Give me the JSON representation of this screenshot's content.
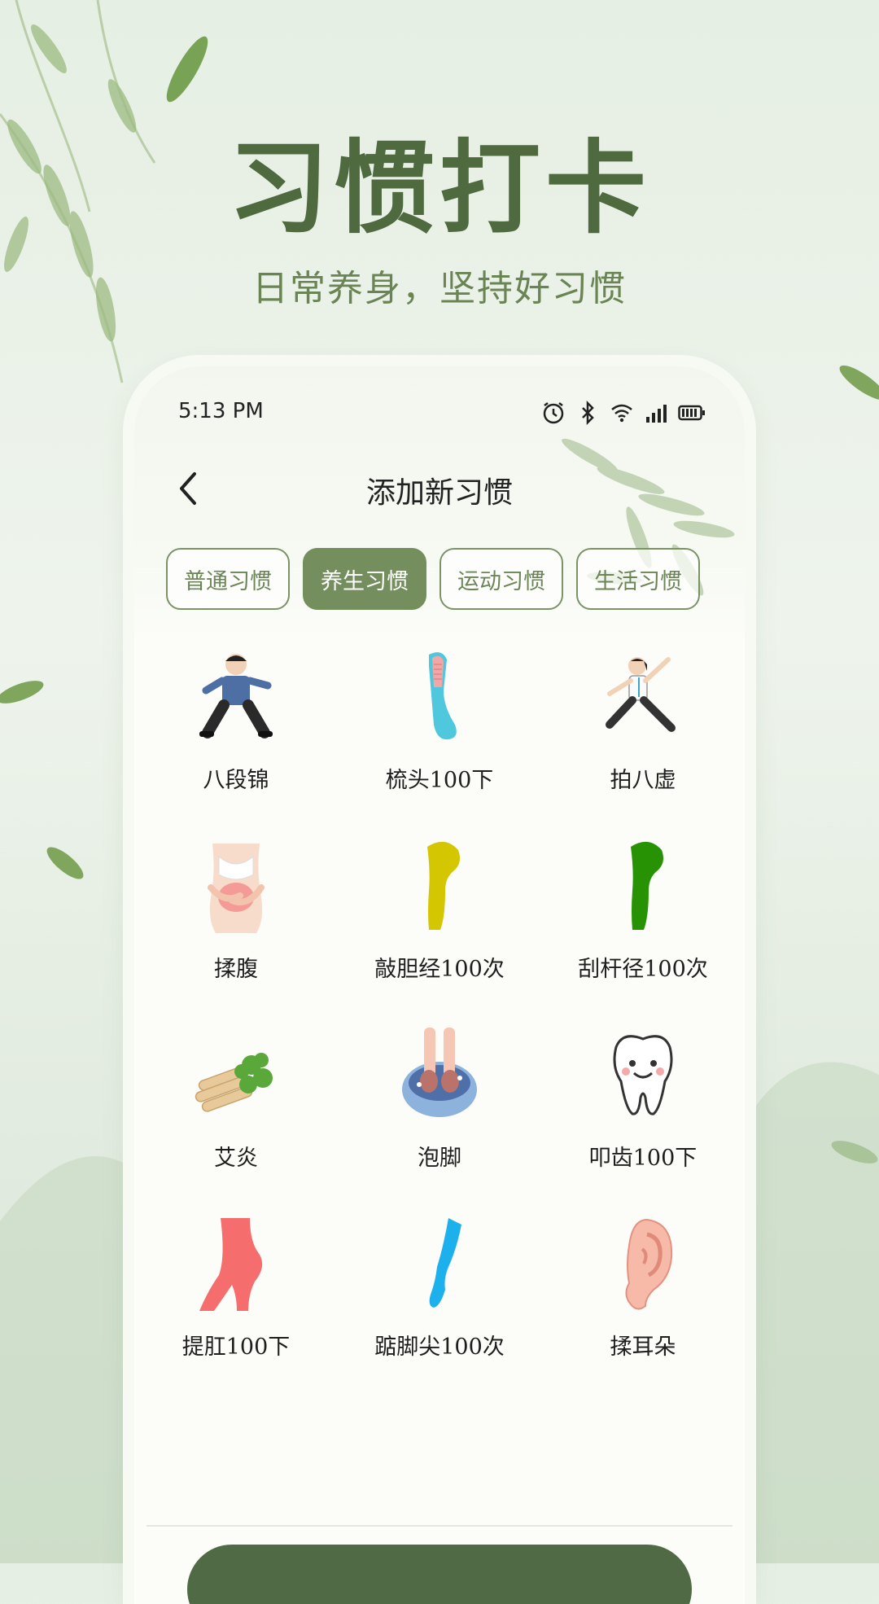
{
  "hero": {
    "title": "习惯打卡",
    "subtitle": "日常养身，坚持好习惯"
  },
  "status_bar": {
    "time": "5:13 PM",
    "icons": [
      "alarm-icon",
      "bluetooth-icon",
      "wifi-icon",
      "signal-icon",
      "battery-icon"
    ]
  },
  "nav": {
    "back_icon": "chevron-left-icon",
    "title": "添加新习惯"
  },
  "tabs": [
    {
      "label": "普通习惯",
      "active": false
    },
    {
      "label": "养生习惯",
      "active": true
    },
    {
      "label": "运动习惯",
      "active": false
    },
    {
      "label": "生活习惯",
      "active": false
    }
  ],
  "habits": [
    {
      "label": "八段锦",
      "icon": "tai-chi-man-icon"
    },
    {
      "label": "梳头100下",
      "icon": "comb-icon"
    },
    {
      "label": "拍八虚",
      "icon": "kung-fu-woman-icon"
    },
    {
      "label": "揉腹",
      "icon": "belly-massage-icon"
    },
    {
      "label": "敲胆经100次",
      "icon": "leg-yellow-icon"
    },
    {
      "label": "刮杆径100次",
      "icon": "leg-green-icon"
    },
    {
      "label": "艾炎",
      "icon": "moxa-herb-icon"
    },
    {
      "label": "泡脚",
      "icon": "foot-bath-icon"
    },
    {
      "label": "叩齿100下",
      "icon": "tooth-icon"
    },
    {
      "label": "提肛100下",
      "icon": "hip-red-icon"
    },
    {
      "label": "踮脚尖100次",
      "icon": "tiptoe-foot-icon"
    },
    {
      "label": "揉耳朵",
      "icon": "ear-icon"
    }
  ],
  "colors": {
    "brand_green": "#748e5e",
    "button_dark_green": "#506a45",
    "title_green": "#4f6a3f"
  }
}
